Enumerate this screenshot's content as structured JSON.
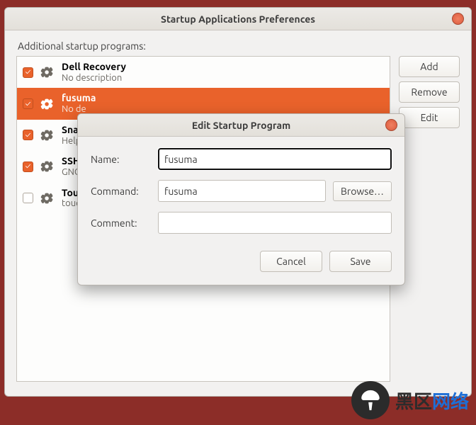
{
  "mainWindow": {
    "title": "Startup Applications Preferences",
    "sectionLabel": "Additional startup programs:",
    "buttons": {
      "add": "Add",
      "remove": "Remove",
      "edit": "Edit"
    },
    "items": [
      {
        "title": "Dell Recovery",
        "desc": "No description",
        "checked": true,
        "selected": false
      },
      {
        "title": "fusuma",
        "desc": "No de",
        "checked": true,
        "selected": true
      },
      {
        "title": "Snap",
        "desc": "Helpe",
        "checked": true,
        "selected": false
      },
      {
        "title": "SSH K",
        "desc": "GNOM",
        "checked": true,
        "selected": false
      },
      {
        "title": "Touch",
        "desc": "touch",
        "checked": false,
        "selected": false
      }
    ]
  },
  "dialog": {
    "title": "Edit Startup Program",
    "labels": {
      "name": "Name:",
      "command": "Command:",
      "comment": "Comment:"
    },
    "fields": {
      "name": "fusuma",
      "command": "fusuma",
      "comment": ""
    },
    "browse": "Browse…",
    "buttons": {
      "cancel": "Cancel",
      "save": "Save"
    }
  },
  "watermark": {
    "text1": "黑区",
    "text2": "网络"
  }
}
